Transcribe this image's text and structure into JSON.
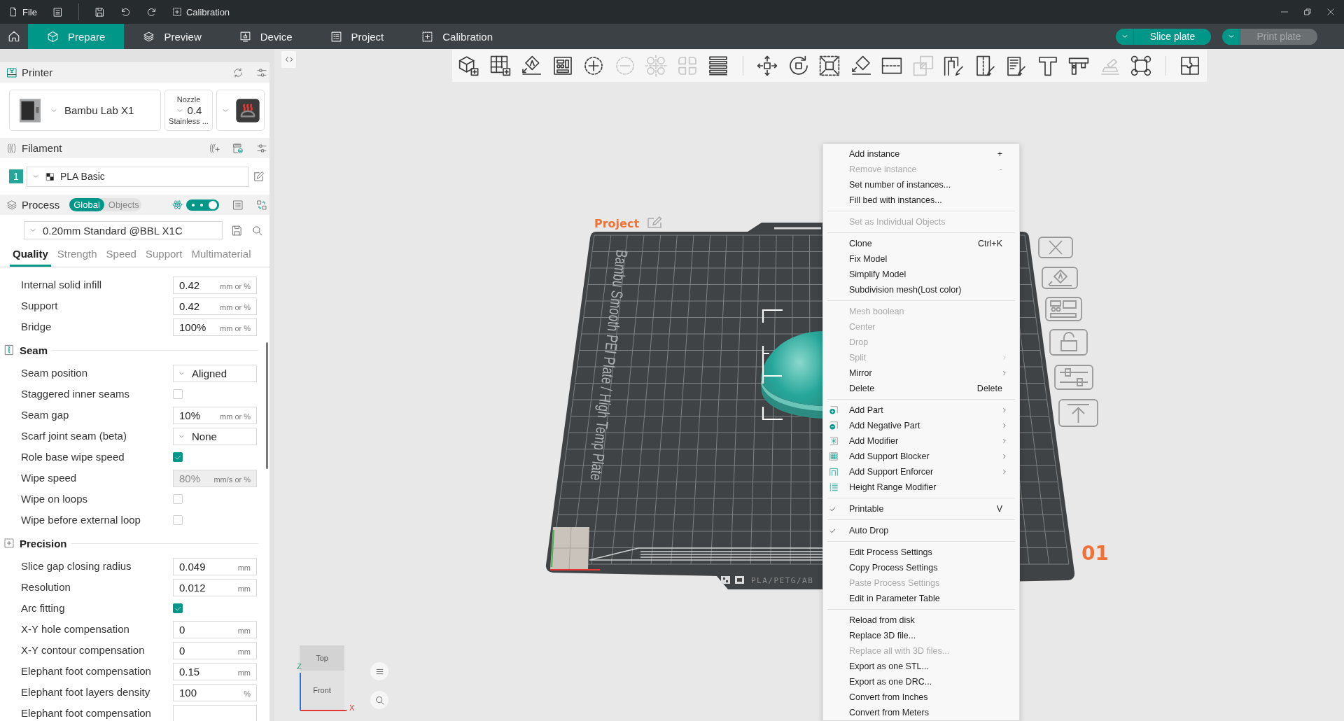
{
  "title_bar": {
    "file_label": "File",
    "calibration_label": "Calibration"
  },
  "tabs": [
    {
      "kind": "prepare",
      "label": "Prepare",
      "selected": true
    },
    {
      "kind": "preview",
      "label": "Preview",
      "selected": false
    },
    {
      "kind": "device",
      "label": "Device",
      "selected": false
    },
    {
      "kind": "project",
      "label": "Project",
      "selected": false
    },
    {
      "kind": "calibration",
      "label": "Calibration",
      "selected": false
    }
  ],
  "actions": [
    {
      "label": "Slice plate",
      "disabled": false
    },
    {
      "label": "Print plate",
      "disabled": true
    }
  ],
  "sidebar": {
    "printer": {
      "title": "Printer",
      "model": "Bambu Lab X1",
      "nozzle_title": "Nozzle",
      "nozzle_size": "0.4",
      "nozzle_type": "Stainless ..."
    },
    "filament": {
      "title": "Filament",
      "slots": [
        {
          "number": "1",
          "name": "PLA Basic",
          "color": "#26a69a"
        }
      ]
    },
    "process": {
      "title": "Process",
      "scope": [
        {
          "label": "Global",
          "selected": true
        },
        {
          "label": "Objects",
          "selected": false
        }
      ],
      "advanced_toggle": {
        "on": true
      },
      "preset": "0.20mm Standard @BBL X1C",
      "tabs": [
        {
          "label": "Quality",
          "selected": true
        },
        {
          "label": "Strength",
          "selected": false
        },
        {
          "label": "Speed",
          "selected": false
        },
        {
          "label": "Support",
          "selected": false
        },
        {
          "label": "Multimaterial",
          "selected": false
        }
      ]
    },
    "settings": {
      "rows": [
        {
          "kind": "number",
          "label": "Internal solid infill",
          "value": "0.42",
          "unit": "mm or %",
          "disabled": false
        },
        {
          "kind": "number",
          "label": "Support",
          "value": "0.42",
          "unit": "mm or %",
          "disabled": false
        },
        {
          "kind": "number",
          "label": "Bridge",
          "value": "100%",
          "unit": "mm or %",
          "disabled": false
        }
      ],
      "sections": [
        {
          "title": "Seam",
          "rows": [
            {
              "kind": "select",
              "label": "Seam position",
              "value": "Aligned",
              "disabled": false
            },
            {
              "kind": "checkbox",
              "label": "Staggered inner seams",
              "checked": false,
              "disabled": false
            },
            {
              "kind": "number",
              "label": "Seam gap",
              "value": "10%",
              "unit": "mm or %",
              "disabled": false
            },
            {
              "kind": "select",
              "label": "Scarf joint seam (beta)",
              "value": "None",
              "disabled": false
            },
            {
              "kind": "checkbox",
              "label": "Role base wipe speed",
              "checked": true,
              "disabled": false
            },
            {
              "kind": "number",
              "label": "Wipe speed",
              "value": "80%",
              "unit": "mm/s or %",
              "disabled": true
            },
            {
              "kind": "checkbox",
              "label": "Wipe on loops",
              "checked": false,
              "disabled": false
            },
            {
              "kind": "checkbox",
              "label": "Wipe before external loop",
              "checked": false,
              "disabled": false
            }
          ]
        },
        {
          "title": "Precision",
          "rows": [
            {
              "kind": "number",
              "label": "Slice gap closing radius",
              "value": "0.049",
              "unit": "mm",
              "disabled": false
            },
            {
              "kind": "number",
              "label": "Resolution",
              "value": "0.012",
              "unit": "mm",
              "disabled": false
            },
            {
              "kind": "checkbox",
              "label": "Arc fitting",
              "checked": true,
              "disabled": false
            },
            {
              "kind": "number",
              "label": "X-Y hole compensation",
              "value": "0",
              "unit": "mm",
              "disabled": false
            },
            {
              "kind": "number",
              "label": "X-Y contour compensation",
              "value": "0",
              "unit": "mm",
              "disabled": false
            },
            {
              "kind": "number",
              "label": "Elephant foot compensation",
              "value": "0.15",
              "unit": "mm",
              "disabled": false
            },
            {
              "kind": "number",
              "label": "Elephant foot layers density",
              "value": "100",
              "unit": "%",
              "disabled": false
            },
            {
              "kind": "number",
              "label": "Elephant foot compensation",
              "disabled": false
            }
          ]
        }
      ]
    }
  },
  "canvas": {
    "toolbar_groups": [
      {
        "tools": [
          {
            "kind": "add",
            "disabled": false
          },
          {
            "kind": "plate",
            "disabled": false
          },
          {
            "kind": "orient",
            "disabled": false
          },
          {
            "kind": "arrange",
            "disabled": false
          },
          {
            "kind": "instanceadd",
            "disabled": false
          },
          {
            "kind": "instanceremove",
            "disabled": true
          },
          {
            "kind": "splitobjects",
            "disabled": true
          },
          {
            "kind": "splitparts",
            "disabled": true
          },
          {
            "kind": "layers",
            "disabled": false
          }
        ]
      },
      {
        "tools": [
          {
            "kind": "move",
            "disabled": false
          },
          {
            "kind": "rotate",
            "disabled": false
          },
          {
            "kind": "scale",
            "disabled": false
          },
          {
            "kind": "flatten",
            "disabled": false
          },
          {
            "kind": "cut",
            "disabled": false
          },
          {
            "kind": "boolean",
            "disabled": true
          },
          {
            "kind": "supports",
            "disabled": false
          },
          {
            "kind": "seam",
            "disabled": false
          },
          {
            "kind": "fuzzy",
            "disabled": false
          },
          {
            "kind": "text",
            "disabled": false
          },
          {
            "kind": "measure",
            "disabled": false
          },
          {
            "kind": "assembly",
            "disabled": true
          },
          {
            "kind": "brimears",
            "disabled": false
          }
        ]
      },
      {
        "tools": [
          {
            "kind": "puzzle",
            "disabled": false
          }
        ]
      }
    ],
    "plate": {
      "project_label": "Project",
      "plate_name": "Bambu Smooth PEI Plate / High Temp Plate",
      "material_note": "PLA/PETG/AB",
      "plate_number": "01"
    },
    "view_cube": {
      "top_label": "Top",
      "front_label": "Front",
      "z_label": "Z",
      "x_label": "X"
    },
    "context_menu": {
      "groups": [
        {
          "items": [
            {
              "label": "Add instance",
              "shortcut": "+",
              "disabled": false
            },
            {
              "label": "Remove instance",
              "shortcut": "-",
              "disabled": true
            },
            {
              "label": "Set number of instances...",
              "disabled": false
            },
            {
              "label": "Fill bed with instances...",
              "disabled": false
            }
          ]
        },
        {
          "items": [
            {
              "label": "Set as Individual Objects",
              "disabled": true
            }
          ]
        },
        {
          "items": [
            {
              "label": "Clone",
              "shortcut": "Ctrl+K",
              "disabled": false
            },
            {
              "label": "Fix Model",
              "disabled": false
            },
            {
              "label": "Simplify Model",
              "disabled": false
            },
            {
              "label": "Subdivision mesh(Lost color)",
              "disabled": false
            }
          ]
        },
        {
          "items": [
            {
              "label": "Mesh boolean",
              "disabled": true,
              "submenu": false
            },
            {
              "label": "Center",
              "disabled": true,
              "submenu": false
            },
            {
              "label": "Drop",
              "disabled": true,
              "submenu": false
            },
            {
              "label": "Split",
              "disabled": true,
              "submenu": true
            },
            {
              "label": "Mirror",
              "disabled": false,
              "submenu": true
            },
            {
              "label": "Delete",
              "shortcut": "Delete",
              "disabled": false,
              "submenu": false
            }
          ]
        },
        {
          "items": [
            {
              "kind": "part",
              "label": "Add Part",
              "disabled": false,
              "submenu": true
            },
            {
              "kind": "negative",
              "label": "Add Negative Part",
              "disabled": false,
              "submenu": true
            },
            {
              "kind": "modifier",
              "label": "Add Modifier",
              "disabled": false,
              "submenu": true
            },
            {
              "kind": "blocker",
              "label": "Add Support Blocker",
              "disabled": false,
              "submenu": true
            },
            {
              "kind": "enforcer",
              "label": "Add Support Enforcer",
              "disabled": false,
              "submenu": true
            },
            {
              "kind": "range",
              "label": "Height Range Modifier",
              "disabled": false,
              "submenu": false
            }
          ]
        },
        {
          "items": [
            {
              "label": "Printable",
              "shortcut": "V",
              "checked": true,
              "disabled": false
            }
          ]
        },
        {
          "items": [
            {
              "label": "Auto Drop",
              "checked": true,
              "disabled": false
            }
          ]
        },
        {
          "items": [
            {
              "label": "Edit Process Settings",
              "disabled": false
            },
            {
              "label": "Copy Process Settings",
              "disabled": false
            },
            {
              "label": "Paste Process Settings",
              "disabled": true
            },
            {
              "label": "Edit in Parameter Table",
              "disabled": false
            }
          ]
        },
        {
          "items": [
            {
              "label": "Reload from disk",
              "disabled": false
            },
            {
              "label": "Replace 3D file...",
              "disabled": false
            },
            {
              "label": "Replace all with 3D files...",
              "disabled": true
            },
            {
              "label": "Export as one STL...",
              "disabled": false
            },
            {
              "label": "Export as one DRC...",
              "disabled": false
            },
            {
              "label": "Convert from Inches",
              "disabled": false
            },
            {
              "label": "Convert from Meters",
              "disabled": false
            }
          ]
        }
      ]
    }
  }
}
